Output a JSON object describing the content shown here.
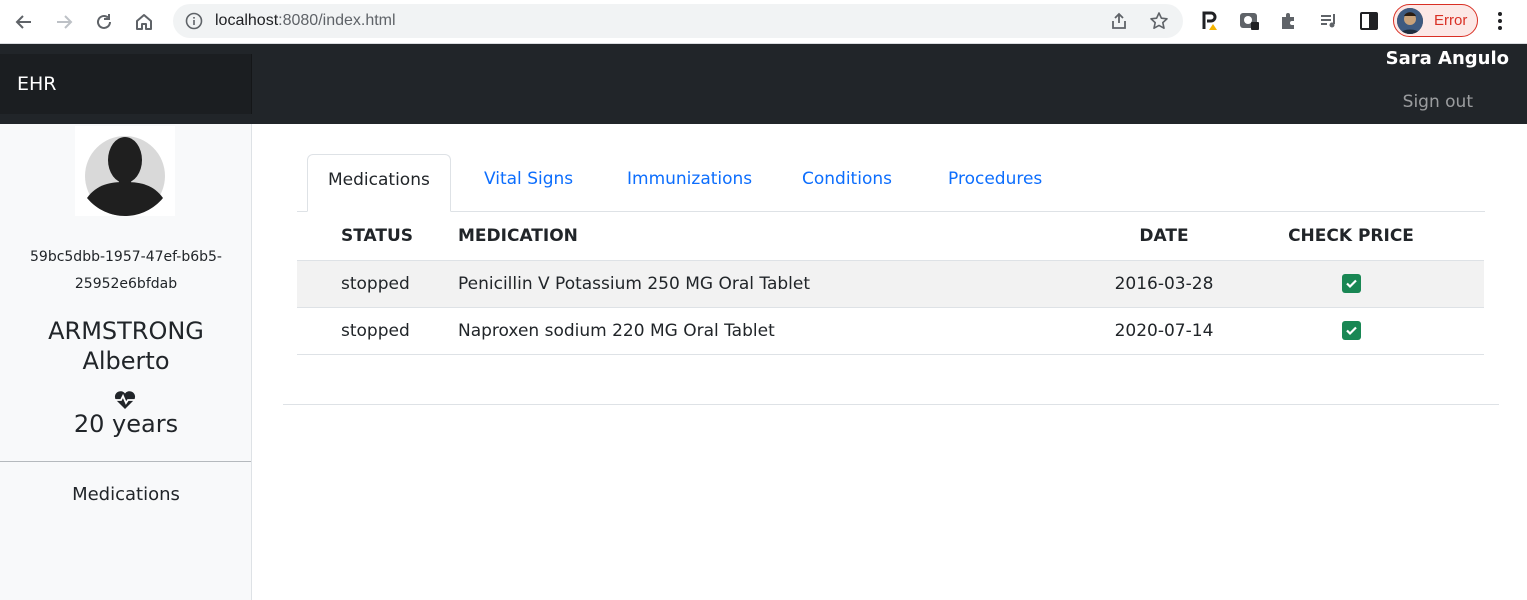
{
  "browser": {
    "url_host": "localhost",
    "url_rest": ":8080/index.html",
    "profile_status": "Error"
  },
  "navbar": {
    "brand": "EHR",
    "user_name": "Sara Angulo",
    "sign_out_label": "Sign out"
  },
  "sidebar": {
    "patient_id_line1": "59bc5dbb-1957-47ef-b6b5-",
    "patient_id_line2": "25952e6bfdab",
    "last_name": "ARMSTRONG",
    "first_name": "Alberto",
    "age": "20 years",
    "nav_label": "Medications"
  },
  "tabs": [
    {
      "label": "Medications",
      "active": true
    },
    {
      "label": "Vital Signs",
      "active": false
    },
    {
      "label": "Immunizations",
      "active": false
    },
    {
      "label": "Conditions",
      "active": false
    },
    {
      "label": "Procedures",
      "active": false
    }
  ],
  "table": {
    "headers": {
      "status": "STATUS",
      "medication": "MEDICATION",
      "date": "DATE",
      "check_price": "CHECK PRICE"
    },
    "rows": [
      {
        "status": "stopped",
        "medication": "Penicillin V Potassium 250 MG Oral Tablet",
        "date": "2016-03-28",
        "checked": true
      },
      {
        "status": "stopped",
        "medication": "Naproxen sodium 220 MG Oral Tablet",
        "date": "2020-07-14",
        "checked": true
      }
    ]
  },
  "colors": {
    "navbar": "#212529",
    "link": "#0d6efd",
    "checkbox": "#198754",
    "error": "#d93025"
  },
  "icons": [
    "back-arrow-icon",
    "forward-arrow-icon",
    "reload-icon",
    "home-icon",
    "info-icon",
    "share-icon",
    "star-icon",
    "extension-icon",
    "puzzle-icon",
    "media-icon",
    "side-panel-icon",
    "kebab-menu-icon",
    "avatar-silhouette-icon",
    "heartbeat-icon",
    "check-icon"
  ]
}
